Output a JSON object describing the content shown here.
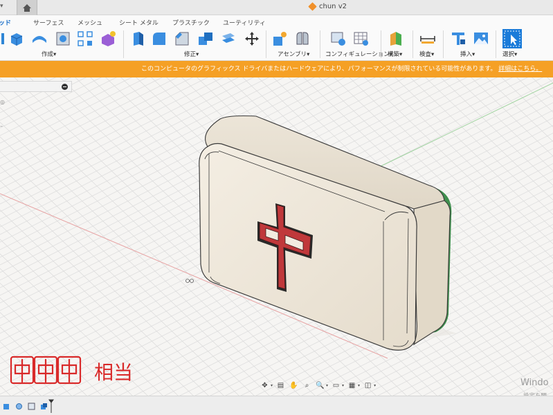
{
  "app": {
    "title_bar": {
      "control": "▾",
      "document_title": "chun v2"
    },
    "tabs": [
      "ッド",
      "サーフェス",
      "メッシュ",
      "シート メタル",
      "プラスチック",
      "ユーティリティ"
    ],
    "toolbar_groups": [
      {
        "label": "作成",
        "dropdown": "▾"
      },
      {
        "label": "修正",
        "dropdown": "▾"
      },
      {
        "label": "アセンブリ",
        "dropdown": "▾"
      },
      {
        "label": "コンフィギュレーション",
        "dropdown": "▾"
      },
      {
        "label": "構築",
        "dropdown": "▾"
      },
      {
        "label": "検査",
        "dropdown": "▾"
      },
      {
        "label": "挿入",
        "dropdown": "▾"
      },
      {
        "label": "選択",
        "dropdown": "▾"
      }
    ],
    "warning": {
      "message": "このコンピュータのグラフィックス ドライバまたはハードウェアにより、パフォーマンスが制限されている可能性があります。",
      "link": "詳細はこちら。"
    },
    "model": {
      "glyph": "中",
      "glyph_color": "#c0383b",
      "tile_color": "#ece4d6",
      "back_color": "#3f8f4d"
    },
    "annotation": {
      "tiles": [
        "中",
        "中",
        "中"
      ],
      "text": "相当"
    },
    "watermark": {
      "line1": "Windo",
      "line2": "設定を開"
    },
    "colors": {
      "accent": "#1a6fc9",
      "warning": "#f5a025"
    }
  }
}
